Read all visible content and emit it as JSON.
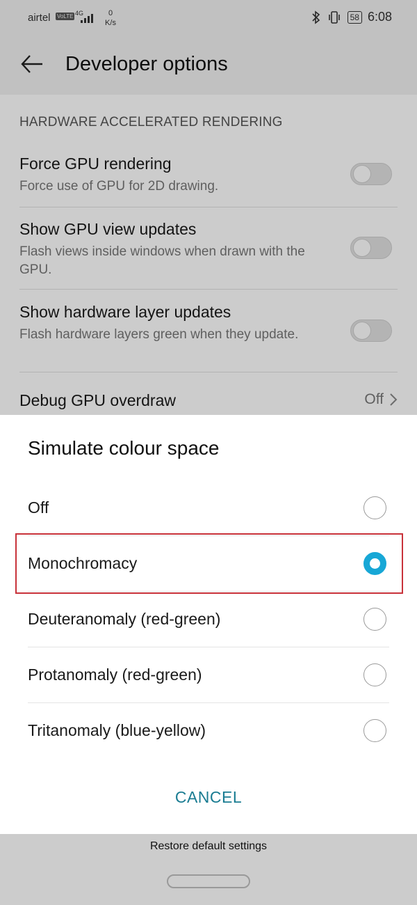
{
  "status_bar": {
    "carrier": "airtel",
    "volte": "VoLTE",
    "network": "4G",
    "speed_value": "0",
    "speed_unit": "K/s",
    "battery": "58",
    "time": "6:08"
  },
  "app_bar": {
    "title": "Developer options"
  },
  "background": {
    "section_header": "HARDWARE ACCELERATED RENDERING",
    "rows": [
      {
        "title": "Force GPU rendering",
        "subtitle": "Force use of GPU for 2D drawing.",
        "toggle_on": false
      },
      {
        "title": "Show GPU view updates",
        "subtitle": "Flash views inside windows when drawn with the GPU.",
        "toggle_on": false
      },
      {
        "title": "Show hardware layer updates",
        "subtitle": "Flash hardware layers green when they update.",
        "toggle_on": false
      }
    ],
    "overdraw": {
      "title": "Debug GPU overdraw",
      "value": "Off"
    }
  },
  "dialog": {
    "title": "Simulate colour space",
    "options": [
      {
        "label": "Off",
        "selected": false
      },
      {
        "label": "Monochromacy",
        "selected": true
      },
      {
        "label": "Deuteranomaly (red-green)",
        "selected": false
      },
      {
        "label": "Protanomaly (red-green)",
        "selected": false
      },
      {
        "label": "Tritanomaly (blue-yellow)",
        "selected": false
      }
    ],
    "cancel_label": "CANCEL"
  },
  "bottom": {
    "restore_label": "Restore default settings"
  },
  "colors": {
    "accent": "#17a7d6",
    "cancel_text": "#1a7c92",
    "highlight_border": "#c8323a"
  }
}
